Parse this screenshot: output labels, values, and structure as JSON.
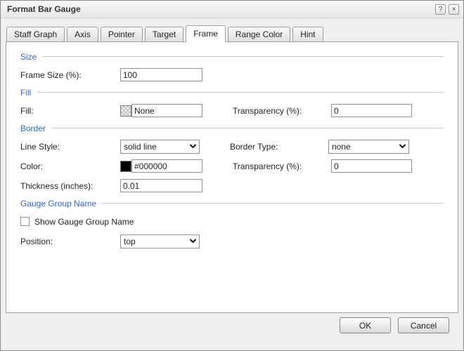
{
  "dialog": {
    "title": "Format Bar Gauge",
    "help_glyph": "?",
    "close_glyph": "×"
  },
  "tabs": [
    {
      "label": "Staff Graph",
      "active": false
    },
    {
      "label": "Axis",
      "active": false
    },
    {
      "label": "Pointer",
      "active": false
    },
    {
      "label": "Target",
      "active": false
    },
    {
      "label": "Frame",
      "active": true
    },
    {
      "label": "Range Color",
      "active": false
    },
    {
      "label": "Hint",
      "active": false
    }
  ],
  "size": {
    "heading": "Size",
    "frame_size_label": "Frame Size (%):",
    "frame_size_value": "100"
  },
  "fill": {
    "heading": "Fill",
    "fill_label": "Fill:",
    "fill_value": "None",
    "transparency_label": "Transparency (%):",
    "transparency_value": "0"
  },
  "border": {
    "heading": "Border",
    "line_style_label": "Line Style:",
    "line_style_value": "solid line",
    "border_type_label": "Border Type:",
    "border_type_value": "none",
    "color_label": "Color:",
    "color_value": "#000000",
    "swatch_color": "#000000",
    "transparency_label": "Transparency (%):",
    "transparency_value": "0",
    "thickness_label": "Thickness (inches):",
    "thickness_value": "0.01"
  },
  "gauge_group": {
    "heading": "Gauge Group Name",
    "checkbox_label": "Show Gauge Group Name",
    "checkbox_checked": false,
    "position_label": "Position:",
    "position_value": "top"
  },
  "footer": {
    "ok_label": "OK",
    "cancel_label": "Cancel"
  },
  "colors": {
    "heading_blue": "#3366cc",
    "dialog_bg": "#efefef",
    "panel_bg": "#ffffff"
  }
}
